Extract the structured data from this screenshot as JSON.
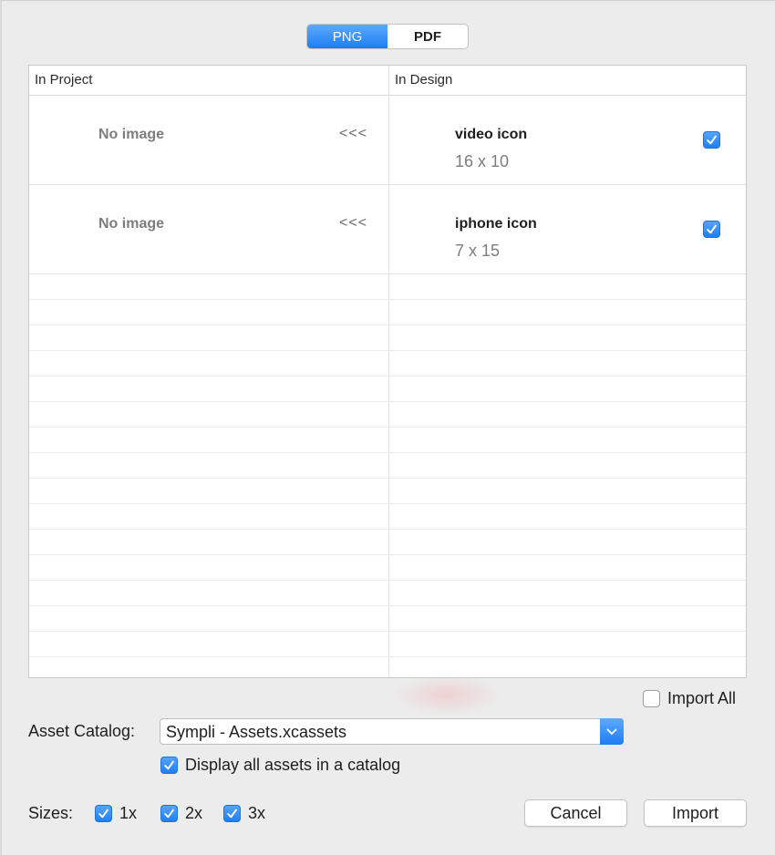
{
  "format_tabs": [
    {
      "label": "PNG",
      "active": true
    },
    {
      "label": "PDF",
      "active": false
    }
  ],
  "table": {
    "columns": [
      "In Project",
      "In Design"
    ],
    "rows": [
      {
        "project": "No image",
        "arrow": "<<<",
        "name": "video icon",
        "size": "16 x 10",
        "checked": true
      },
      {
        "project": "No image",
        "arrow": "<<<",
        "name": "iphone icon",
        "size": "7 x 15",
        "checked": true
      }
    ]
  },
  "import_all": {
    "label": "Import All",
    "checked": false
  },
  "asset_catalog": {
    "label": "Asset Catalog:",
    "value": "Sympli - Assets.xcassets"
  },
  "display_all": {
    "label": "Display all assets in a catalog",
    "checked": true
  },
  "sizes": {
    "label": "Sizes:",
    "options": [
      {
        "label": "1x",
        "checked": true
      },
      {
        "label": "2x",
        "checked": true
      },
      {
        "label": "3x",
        "checked": true
      }
    ]
  },
  "buttons": {
    "cancel": "Cancel",
    "import": "Import"
  },
  "colors": {
    "accent": "#1b7ef5",
    "background": "#ececec"
  }
}
